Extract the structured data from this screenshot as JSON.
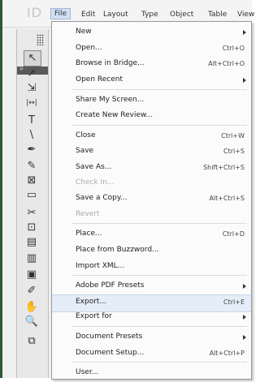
{
  "menubar": {
    "app_logo": "ID",
    "items": [
      "File",
      "Edit",
      "Layout",
      "Type",
      "Object",
      "Table",
      "View"
    ]
  },
  "toolbox": {
    "tools": [
      {
        "glyph": "↖",
        "name": "selection-tool-icon"
      },
      {
        "glyph": "↗",
        "name": "direct-selection-tool-icon"
      },
      {
        "glyph": "⇲",
        "name": "page-tool-icon"
      },
      {
        "glyph": "|↔|",
        "name": "gap-tool-icon"
      },
      {
        "glyph": "T",
        "name": "type-tool-icon"
      },
      {
        "glyph": "\\",
        "name": "line-tool-icon"
      },
      {
        "glyph": "✒",
        "name": "pen-tool-icon"
      },
      {
        "glyph": "✎",
        "name": "pencil-tool-icon"
      },
      {
        "glyph": "⊠",
        "name": "rectangle-frame-tool-icon"
      },
      {
        "glyph": "▭",
        "name": "rectangle-tool-icon"
      },
      {
        "glyph": "✂",
        "name": "scissors-tool-icon"
      },
      {
        "glyph": "⊡",
        "name": "free-transform-tool-icon"
      },
      {
        "glyph": "▤",
        "name": "gradient-swatch-tool-icon"
      },
      {
        "glyph": "▥",
        "name": "gradient-feather-tool-icon"
      },
      {
        "glyph": "▣",
        "name": "note-tool-icon"
      },
      {
        "glyph": "✐",
        "name": "eyedropper-tool-icon"
      },
      {
        "glyph": "✋",
        "name": "hand-tool-icon"
      },
      {
        "glyph": "🔍",
        "name": "zoom-tool-icon"
      },
      {
        "glyph": "⧉",
        "name": "fill-stroke-icon"
      }
    ]
  },
  "file_menu": {
    "items": [
      {
        "label": "New",
        "shortcut": "",
        "submenu": true,
        "disabled": false,
        "highlighted": false
      },
      {
        "label": "Open...",
        "shortcut": "Ctrl+O",
        "submenu": false,
        "disabled": false,
        "highlighted": false
      },
      {
        "label": "Browse in Bridge...",
        "shortcut": "Alt+Ctrl+O",
        "submenu": false,
        "disabled": false,
        "highlighted": false
      },
      {
        "label": "Open Recent",
        "shortcut": "",
        "submenu": true,
        "disabled": false,
        "highlighted": false
      },
      {
        "label": "Share My Screen...",
        "shortcut": "",
        "submenu": false,
        "disabled": false,
        "highlighted": false
      },
      {
        "label": "Create New Review...",
        "shortcut": "",
        "submenu": false,
        "disabled": false,
        "highlighted": false
      },
      {
        "label": "Close",
        "shortcut": "Ctrl+W",
        "submenu": false,
        "disabled": false,
        "highlighted": false
      },
      {
        "label": "Save",
        "shortcut": "Ctrl+S",
        "submenu": false,
        "disabled": false,
        "highlighted": false
      },
      {
        "label": "Save As...",
        "shortcut": "Shift+Ctrl+S",
        "submenu": false,
        "disabled": false,
        "highlighted": false
      },
      {
        "label": "Check In...",
        "shortcut": "",
        "submenu": false,
        "disabled": true,
        "highlighted": false
      },
      {
        "label": "Save a Copy...",
        "shortcut": "Alt+Ctrl+S",
        "submenu": false,
        "disabled": false,
        "highlighted": false
      },
      {
        "label": "Revert",
        "shortcut": "",
        "submenu": false,
        "disabled": true,
        "highlighted": false
      },
      {
        "label": "Place...",
        "shortcut": "Ctrl+D",
        "submenu": false,
        "disabled": false,
        "highlighted": false
      },
      {
        "label": "Place from Buzzword...",
        "shortcut": "",
        "submenu": false,
        "disabled": false,
        "highlighted": false
      },
      {
        "label": "Import XML...",
        "shortcut": "",
        "submenu": false,
        "disabled": false,
        "highlighted": false
      },
      {
        "label": "Adobe PDF Presets",
        "shortcut": "",
        "submenu": true,
        "disabled": false,
        "highlighted": false
      },
      {
        "label": "Export...",
        "shortcut": "Ctrl+E",
        "submenu": false,
        "disabled": false,
        "highlighted": true
      },
      {
        "label": "Export for",
        "shortcut": "",
        "submenu": true,
        "disabled": false,
        "highlighted": false
      },
      {
        "label": "Document Presets",
        "shortcut": "",
        "submenu": true,
        "disabled": false,
        "highlighted": false
      },
      {
        "label": "Document Setup...",
        "shortcut": "Alt+Ctrl+P",
        "submenu": false,
        "disabled": false,
        "highlighted": false
      },
      {
        "label": "User...",
        "shortcut": "",
        "submenu": false,
        "disabled": false,
        "highlighted": false
      }
    ]
  }
}
